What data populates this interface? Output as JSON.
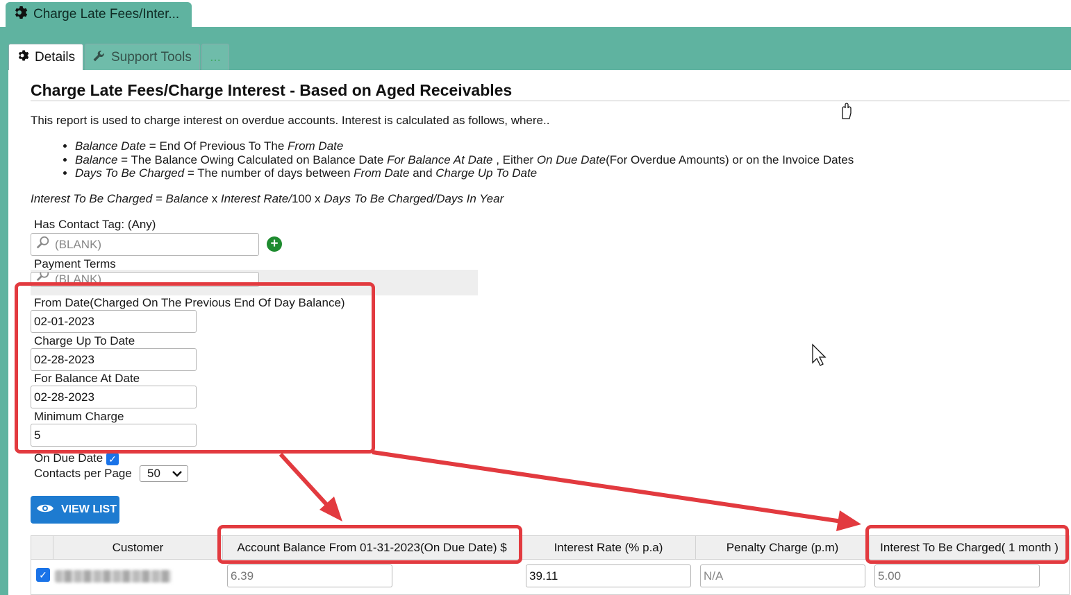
{
  "window": {
    "tab_title": "Charge Late Fees/Inter..."
  },
  "tabs": [
    {
      "label": "Details",
      "active": true,
      "icon": "gear-icon"
    },
    {
      "label": "Support Tools",
      "active": false,
      "icon": "wrench-icon"
    },
    {
      "label": "...",
      "active": false
    }
  ],
  "page": {
    "title": "Charge Late Fees/Charge Interest - Based on Aged Receivables",
    "intro": "This report is used to charge interest on overdue accounts. Interest is calculated as follows, where..",
    "bullets": [
      {
        "term": "Balance Date",
        "text_1": " = End Of Previous To The ",
        "italic_1": "From Date"
      },
      {
        "term": "Balance",
        "text_1": " = The Balance Owing Calculated on Balance Date ",
        "italic_1": "For Balance At Date",
        "text_2": " , Either ",
        "italic_2": "On Due Date",
        "text_3": "(For Overdue Amounts) or on the Invoice Dates"
      },
      {
        "term": "Days To Be Charged",
        "text_1": " = The number of days between ",
        "italic_1": "From Date",
        "text_2": " and ",
        "italic_2": "Charge Up To Date"
      }
    ],
    "formula": {
      "part1": "Interest To Be Charged = Balance ",
      "x1": "x",
      "part2": " Interest Rate/",
      "n100": "100 x",
      "part3": " Days To Be Charged/Days In Year"
    }
  },
  "filters": {
    "contact_tag_label": "Has Contact Tag: (Any)",
    "contact_tag_placeholder": "(BLANK)",
    "payment_terms_label": "Payment Terms",
    "payment_terms_placeholder": "(BLANK)",
    "from_date_label": "From Date(Charged On The Previous End Of Day Balance)",
    "from_date": "02-01-2023",
    "charge_up_to_label": "Charge Up To Date",
    "charge_up_to": "02-28-2023",
    "balance_at_label": "For Balance At Date",
    "balance_at": "02-28-2023",
    "min_charge_label": "Minimum Charge",
    "min_charge": "5",
    "on_due_date_label": "On Due Date",
    "on_due_date_checked": true,
    "contacts_per_page_label": "Contacts per Page",
    "contacts_per_page": "50"
  },
  "actions": {
    "view_list": "VIEW LIST"
  },
  "grid": {
    "columns": [
      "",
      "Customer",
      "Account Balance From 01-31-2023(On Due Date) $",
      "Interest Rate (% p.a)",
      "Penalty Charge (p.m)",
      "Interest To Be Charged( 1 month )"
    ],
    "rows": [
      {
        "selected": true,
        "customer": "",
        "balance": "6.39",
        "interest_rate": "39.11",
        "penalty": "N/A",
        "interest": "5.00"
      }
    ]
  },
  "colors": {
    "accent_teal": "#5fb3a0",
    "highlight_red": "#e23a3f",
    "button_blue": "#1e7bd0"
  }
}
